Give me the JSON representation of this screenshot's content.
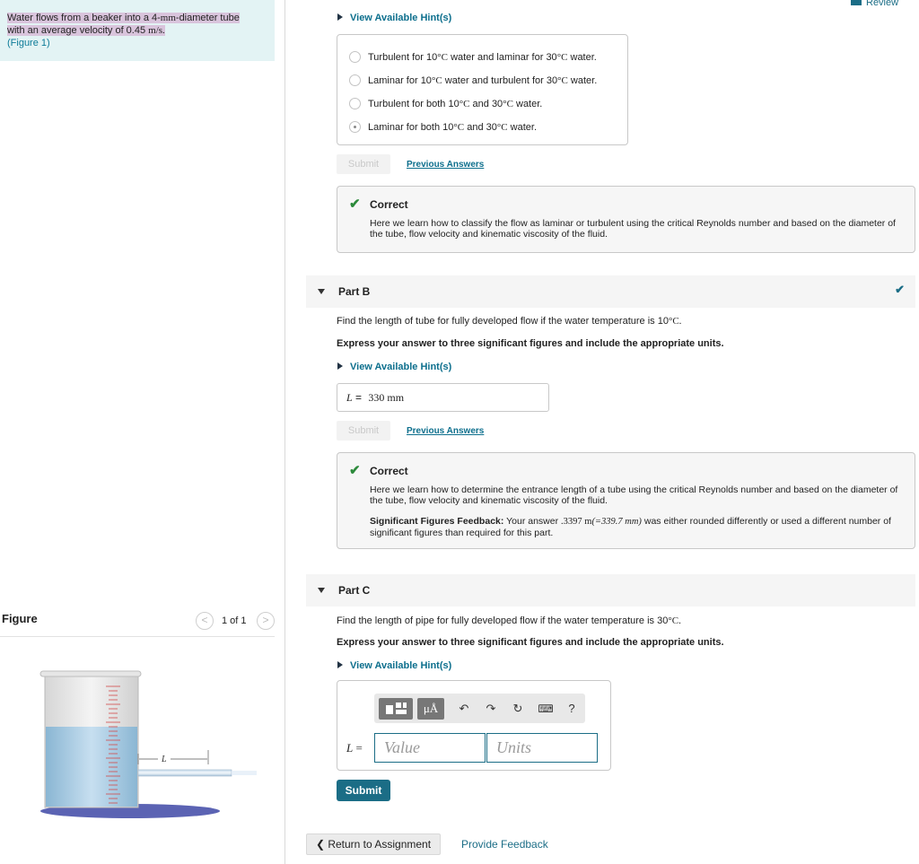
{
  "problem": {
    "text_line1": "Water flows from a beaker into a 4-",
    "text_unit1": "mm",
    "text_line1b": "-diameter tube",
    "text_line2": "with an average velocity of 0.45",
    "text_unit2": "m/s.",
    "figure_link": "(Figure 1)"
  },
  "figure_panel": {
    "title": "Figure",
    "count": "1 of 1",
    "prev_glyph": "<",
    "next_glyph": ">",
    "length_label": "L"
  },
  "review_link": "Review",
  "part_a": {
    "hint": "View Available Hint(s)",
    "options": [
      {
        "pre": "Turbulent for 10",
        "deg": "°",
        "unit": "C",
        "mid": "water and laminar for 30",
        "deg2": "°",
        "unit2": "C",
        "post": "water."
      },
      {
        "pre": "Laminar for 10",
        "deg": "°",
        "unit": "C",
        "mid": "water and turbulent for 30",
        "deg2": "°",
        "unit2": "C",
        "post": "water."
      },
      {
        "pre": "Turbulent for both 10",
        "deg": "°",
        "unit": "C",
        "mid": "and 30",
        "deg2": "°",
        "unit2": "C",
        "post": "water."
      },
      {
        "pre": "Laminar for both 10",
        "deg": "°",
        "unit": "C",
        "mid": "and 30",
        "deg2": "°",
        "unit2": "C",
        "post": "water."
      }
    ],
    "selected_index": 3,
    "submit_label": "Submit",
    "previous_answers": "Previous Answers",
    "correct_title": "Correct",
    "correct_text": "Here we learn how to classify the flow as laminar or turbulent using the critical Reynolds number and based on the diameter of the tube, flow velocity and kinematic viscosity of the fluid."
  },
  "part_b": {
    "title": "Part B",
    "question_pre": "Find the length of tube for fully developed flow if the water temperature is 10",
    "question_unit": "°C.",
    "instruction": "Express your answer to three significant figures and include the appropriate units.",
    "hint": "View Available Hint(s)",
    "answer_var": "L",
    "answer_eq": "=",
    "answer_value": "330 mm",
    "submit_label": "Submit",
    "previous_answers": "Previous Answers",
    "correct_title": "Correct",
    "correct_text": "Here we learn how to determine the entrance length of a tube using the critical Reynolds number and based on the diameter of the tube, flow velocity and kinematic viscosity of the fluid.",
    "sig_label": "Significant Figures Feedback:",
    "sig_text_pre": "Your answer",
    "sig_value": ".3397 m",
    "sig_paren": "(=339.7 mm)",
    "sig_text_post": "was either rounded differently or used a different number of significant figures than required for this part."
  },
  "part_c": {
    "title": "Part C",
    "question_pre": "Find the length of pipe for fully developed flow if the water temperature is 30",
    "question_unit": "°C.",
    "instruction": "Express your answer to three significant figures and include the appropriate units.",
    "hint": "View Available Hint(s)",
    "answer_var": "L",
    "answer_eq": "=",
    "value_placeholder": "Value",
    "units_placeholder": "Units",
    "toolbar_units_label": "μÅ",
    "toolbar_help": "?",
    "submit_label": "Submit"
  },
  "footer": {
    "return_label": "Return to Assignment",
    "feedback_label": "Provide Feedback"
  },
  "colors": {
    "accent": "#1b6d86",
    "correct_green": "#2c8a3b",
    "problem_bg": "#e3f3f4",
    "highlight": "#d9c4dc"
  }
}
